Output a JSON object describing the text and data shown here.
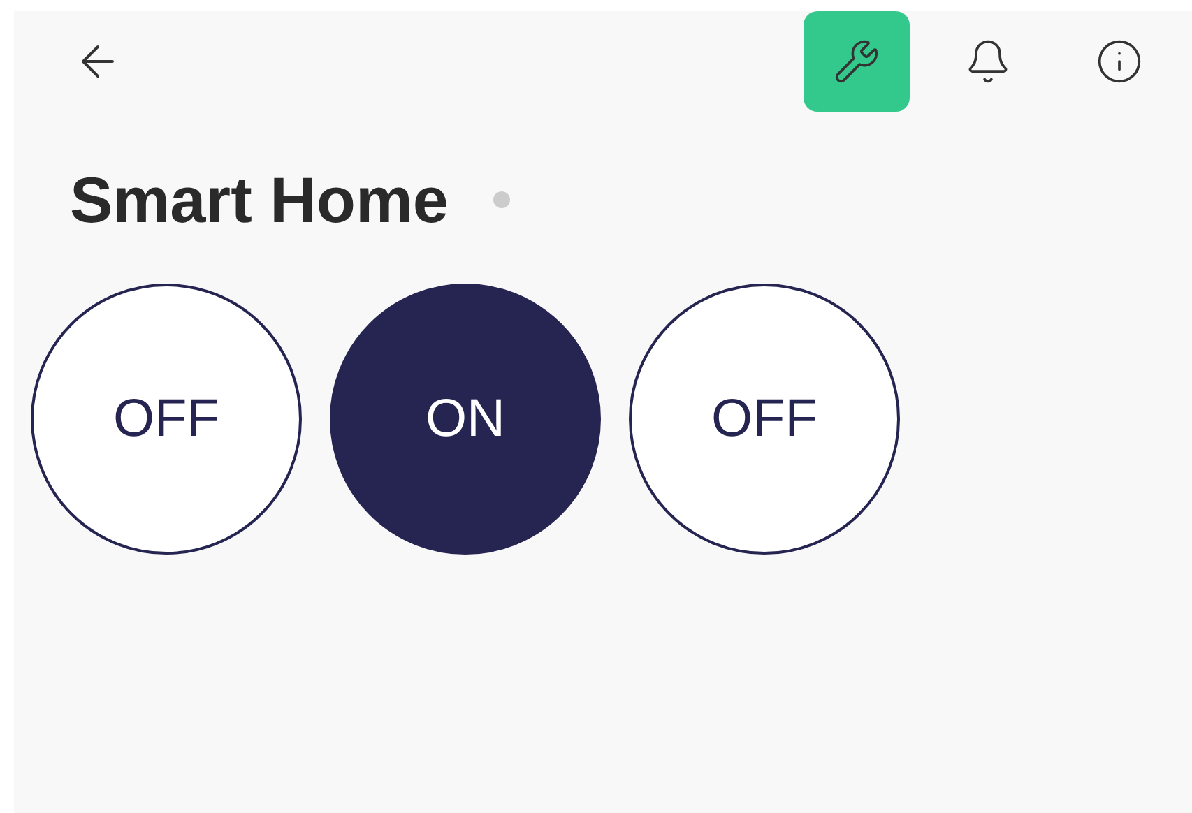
{
  "toolbar": [
    {
      "kind": "wrench",
      "selected": true
    },
    {
      "kind": "bell",
      "selected": false
    },
    {
      "kind": "info",
      "selected": false
    }
  ],
  "title": "Smart Home",
  "status_dot": {
    "color": "#cccccc"
  },
  "switches": [
    {
      "label": "OFF",
      "on": false
    },
    {
      "label": "ON",
      "on": true
    },
    {
      "label": "OFF",
      "on": false
    }
  ]
}
